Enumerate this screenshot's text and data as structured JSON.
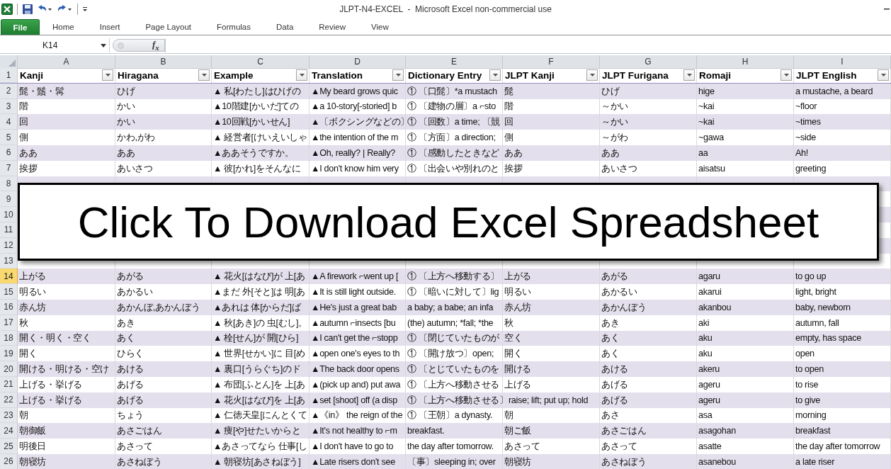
{
  "window": {
    "title": "JLPT-N4-EXCEL  -  Microsoft Excel non-commercial use"
  },
  "ribbon_tabs": [
    {
      "label": "File",
      "kind": "file"
    },
    {
      "label": "Home",
      "kind": "tab"
    },
    {
      "label": "Insert",
      "kind": "tab"
    },
    {
      "label": "Page Layout",
      "kind": "tab"
    },
    {
      "label": "Formulas",
      "kind": "tab"
    },
    {
      "label": "Data",
      "kind": "tab"
    },
    {
      "label": "Review",
      "kind": "tab"
    },
    {
      "label": "View",
      "kind": "tab"
    }
  ],
  "formula_bar": {
    "name_box": "K14",
    "function_label": "f$_{x}$"
  },
  "header_row_number": "1",
  "columns": [
    {
      "letter": "A",
      "title": "Kanji"
    },
    {
      "letter": "B",
      "title": "Hiragana"
    },
    {
      "letter": "C",
      "title": "Example"
    },
    {
      "letter": "D",
      "title": "Translation"
    },
    {
      "letter": "E",
      "title": "Dictionary Entry"
    },
    {
      "letter": "F",
      "title": "JLPT Kanji"
    },
    {
      "letter": "G",
      "title": "JLPT Furigana"
    },
    {
      "letter": "H",
      "title": "Romaji"
    },
    {
      "letter": "I",
      "title": "JLPT English"
    }
  ],
  "rows": [
    {
      "number": "2",
      "selected": false,
      "cells": [
        "髭・鬚・髯",
        "ひげ",
        "▲ 私[わたし]はひげの",
        "▲My beard grows quic",
        "① 〔口髭〕*a mustach",
        "髭",
        "ひげ",
        "hige",
        "a mustache, a beard"
      ]
    },
    {
      "number": "3",
      "selected": false,
      "cells": [
        "階",
        "かい",
        "▲10階建[かいだ]ての",
        "▲a 10-story[-storied] b",
        "① 〔建物の層〕a ⌐sto",
        "階",
        "～かい",
        "~kai",
        "~floor"
      ]
    },
    {
      "number": "4",
      "selected": false,
      "cells": [
        "回",
        "かい",
        "▲10回戦[かいせん]",
        "▲〔ボクシングなどの〕",
        "① 〔回数〕a time; 〔競",
        "回",
        "～かい",
        "~kai",
        "~times"
      ]
    },
    {
      "number": "5",
      "selected": false,
      "cells": [
        "側",
        "かわ,がわ",
        "▲ 経営者[けいえいしゃ",
        "▲the intention of the m",
        "① 〔方面〕a direction;",
        "側",
        "～がわ",
        "~gawa",
        "~side"
      ]
    },
    {
      "number": "6",
      "selected": false,
      "cells": [
        "ああ",
        "ああ",
        "▲ああそうですか。",
        "▲Oh, really? | Really?",
        "① 〔感動したときなど",
        "ああ",
        "ああ",
        "aa",
        "Ah!"
      ]
    },
    {
      "number": "7",
      "selected": false,
      "cells": [
        "挨拶",
        "あいさつ",
        "▲ 彼[かれ]をそんなに",
        "▲I don't know him very",
        "① 〔出会いや別れのと",
        "挨拶",
        "あいさつ",
        "aisatsu",
        "greeting"
      ]
    },
    {
      "number": "8",
      "selected": false
    },
    {
      "number": "9",
      "selected": false
    },
    {
      "number": "10",
      "selected": false
    },
    {
      "number": "11",
      "selected": false
    },
    {
      "number": "12",
      "selected": false
    },
    {
      "number": "13",
      "selected": false
    },
    {
      "number": "14",
      "selected": true,
      "cells": [
        "上がる",
        "あがる",
        "▲ 花火[はなび]が 上[あ",
        "▲A firework ⌐went up [",
        "① 〔上方へ移動する〕",
        "上がる",
        "あがる",
        "agaru",
        "to go up"
      ]
    },
    {
      "number": "15",
      "selected": false,
      "cells": [
        "明るい",
        "あかるい",
        "▲まだ 外[そと]は 明[あ",
        "▲It is still light outside.",
        "① 〔暗いに対して〕lig",
        "明るい",
        "あかるい",
        "akarui",
        "light, bright"
      ]
    },
    {
      "number": "16",
      "selected": false,
      "cells": [
        "赤ん坊",
        "あかんぼ,あかんぼう",
        "▲あれは 体[からだ]ば",
        "▲He's just a great bab",
        "a baby; a babe; an infa",
        "赤ん坊",
        "あかんぼう",
        "akanbou",
        "baby, newborn"
      ]
    },
    {
      "number": "17",
      "selected": false,
      "cells": [
        "秋",
        "あき",
        "▲ 秋[あき]の 虫[むし]。",
        "▲autumn ⌐insects [bu",
        "(the) autumn; *fall; *the",
        "秋",
        "あき",
        "aki",
        "autumn, fall"
      ]
    },
    {
      "number": "18",
      "selected": false,
      "cells": [
        "開く・明く・空く",
        "あく",
        "▲ 栓[せん]が 開[ひら]",
        "▲I can't get the ⌐stopp",
        "① 〔閉じていたものが",
        "空く",
        "あく",
        "aku",
        "empty, has space"
      ]
    },
    {
      "number": "19",
      "selected": false,
      "cells": [
        "開く",
        "ひらく",
        "▲ 世界[せかい]に 目[め",
        "▲open one's eyes to th",
        "① 〔開け放つ〕open;",
        "開く",
        "あく",
        "aku",
        "open"
      ]
    },
    {
      "number": "20",
      "selected": false,
      "cells": [
        "開ける・明ける・空け",
        "あける",
        "▲ 裏口[うらぐち]のド",
        "▲The back door opens",
        "① 〔とじていたものを",
        "開ける",
        "あける",
        "akeru",
        "to open"
      ]
    },
    {
      "number": "21",
      "selected": false,
      "cells": [
        "上げる・挙げる",
        "あげる",
        "▲ 布団[ふとん]を 上[あ",
        "▲(pick up and) put awa",
        "① 〔上方へ移動させる",
        "上げる",
        "あげる",
        "ageru",
        "to rise"
      ]
    },
    {
      "number": "22",
      "selected": false,
      "cells": [
        "上げる・挙げる",
        "あげる",
        "▲ 花火[はなび]を 上[あ",
        "▲set [shoot] off (a disp",
        "① 〔上方へ移動させる〕raise; lift; put up; hold",
        null,
        "あげる",
        "ageru",
        "to give"
      ]
    },
    {
      "number": "23",
      "selected": false,
      "cells": [
        "朝",
        "ちょう",
        "▲ 仁徳天皇[にんとくて",
        "▲《in》 the reign of the",
        "① 〔王朝〕a dynasty.",
        "朝",
        "あさ",
        "asa",
        "morning"
      ]
    },
    {
      "number": "24",
      "selected": false,
      "cells": [
        "朝御飯",
        "あさごはん",
        "▲ 痩[や]せたいからと",
        "▲It's not healthy to ⌐m",
        "breakfast.",
        "朝ご飯",
        "あさごはん",
        "asagohan",
        "breakfast"
      ]
    },
    {
      "number": "25",
      "selected": false,
      "cells": [
        "明後日",
        "あさって",
        "▲あさってなら 仕事[し",
        "▲I don't have to go to",
        "the day after tomorrow.",
        "あさって",
        "あさって",
        "asatte",
        "the day after tomorrow"
      ]
    },
    {
      "number": "26",
      "selected": false,
      "cells": [
        "朝寝坊",
        "あさねぼう",
        "▲ 朝寝坊[あさねぼう]",
        "▲Late risers don't see",
        "〔事〕sleeping in; over",
        "朝寝坊",
        "あさねぼう",
        "asanebou",
        "a late riser"
      ]
    }
  ],
  "banner": {
    "label": "Click To Download Excel Spreadsheet"
  }
}
